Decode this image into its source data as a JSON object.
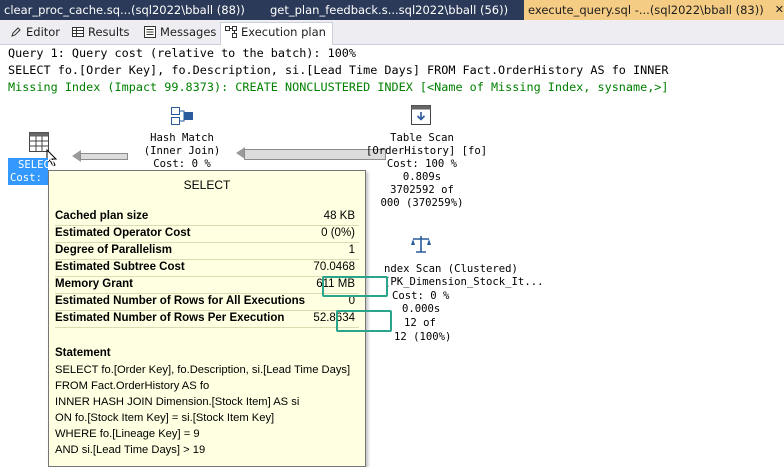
{
  "doc_tabs": [
    {
      "label": "clear_proc_cache.sq...(sql2022\\bball (88))"
    },
    {
      "label": "get_plan_feedback.s...sql2022\\bball (56))"
    },
    {
      "label": "execute_query.sql -...(sql2022\\bball (83))",
      "close": "✕"
    }
  ],
  "sub_tabs": [
    {
      "label": "Editor"
    },
    {
      "label": "Results"
    },
    {
      "label": "Messages"
    },
    {
      "label": "Execution plan"
    }
  ],
  "query": {
    "header": "Query 1: Query cost (relative to the batch): 100%",
    "sql": "SELECT fo.[Order Key], fo.Description, si.[Lead Time Days] FROM Fact.OrderHistory AS fo INNER",
    "missing_index": "Missing Index (Impact 99.8373): CREATE NONCLUSTERED INDEX [<Name of Missing Index, sysname,>]"
  },
  "plan": {
    "select_node": {
      "label1": "SELECT",
      "label2": "Cost:"
    },
    "hash_match": {
      "lines": [
        "Hash Match",
        "(Inner Join)",
        "Cost: 0 %"
      ]
    },
    "table_scan": {
      "lines": [
        "Table Scan",
        "[OrderHistory] [fo]",
        "Cost: 100 %",
        "0.809s",
        "3702592 of",
        "000 (370259%)"
      ]
    },
    "index_scan": {
      "lines": [
        "ndex Scan (Clustered)",
        "[PK_Dimension_Stock_It...",
        "Cost: 0 %",
        "0.000s",
        "12 of",
        "12 (100%)"
      ]
    }
  },
  "tooltip": {
    "title": "SELECT",
    "rows": [
      {
        "key": "Cached plan size",
        "value": "48 KB"
      },
      {
        "key": "Estimated Operator Cost",
        "value": "0 (0%)"
      },
      {
        "key": "Degree of Parallelism",
        "value": "1"
      },
      {
        "key": "Estimated Subtree Cost",
        "value": "70.0468"
      },
      {
        "key": "Memory Grant",
        "value": "611 MB"
      },
      {
        "key": "Estimated Number of Rows for All Executions",
        "value": "0"
      },
      {
        "key": "Estimated Number of Rows Per Execution",
        "value": "52.8634"
      }
    ],
    "statement_title": "Statement",
    "statement_lines": [
      "SELECT fo.[Order Key], fo.Description, si.[Lead Time Days]",
      "FROM  Fact.OrderHistory AS fo",
      "INNER HASH JOIN Dimension.[Stock Item] AS si",
      "ON fo.[Stock Item Key] = si.[Stock Item Key]",
      "WHERE fo.[Lineage Key] = 9",
      "AND si.[Lead Time Days] > 19"
    ]
  },
  "colors": {
    "highlight": "#2aa58c",
    "active_tab": "#f5cc84",
    "tooltip_bg": "#ffffe1"
  }
}
